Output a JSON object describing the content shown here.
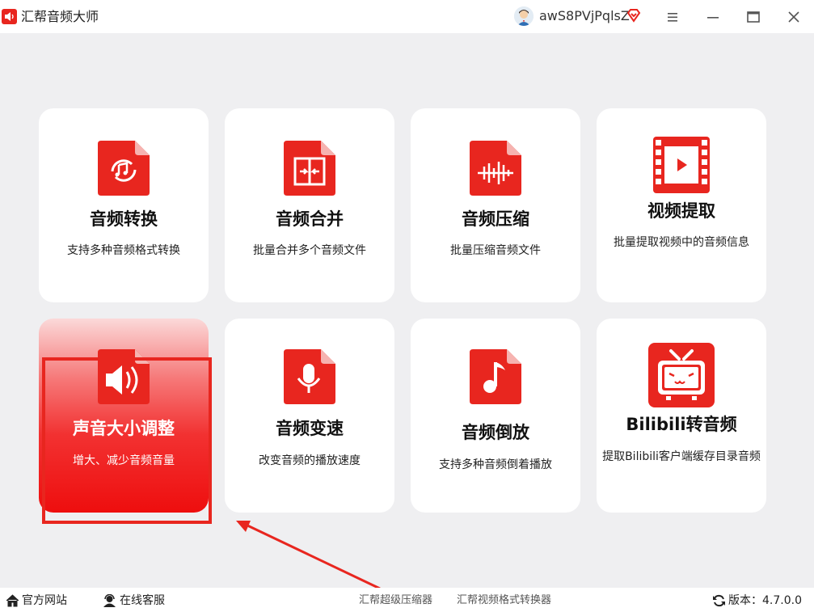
{
  "app": {
    "title": "汇帮音频大师",
    "username": "awS8PVjPqlsZ",
    "accent": "#e8261f"
  },
  "cards": [
    {
      "title": "音频转换",
      "desc": "支持多种音频格式转换"
    },
    {
      "title": "音频合并",
      "desc": "批量合并多个音频文件"
    },
    {
      "title": "音频压缩",
      "desc": "批量压缩音频文件"
    },
    {
      "title": "视频提取",
      "desc": "批量提取视频中的音频信息"
    },
    {
      "title": "声音大小调整",
      "desc": "增大、减少音频音量"
    },
    {
      "title": "音频变速",
      "desc": "改变音频的播放速度"
    },
    {
      "title": "音频倒放",
      "desc": "支持多种音频倒着播放"
    },
    {
      "title": "Bilibili转音频",
      "desc": "提取Bilibili客户端缓存目录音频"
    }
  ],
  "footer": {
    "official_site": "官方网站",
    "online_service": "在线客服",
    "link1": "汇帮超级压缩器",
    "link2": "汇帮视频格式转换器",
    "version": "版本：4.7.0.0"
  }
}
